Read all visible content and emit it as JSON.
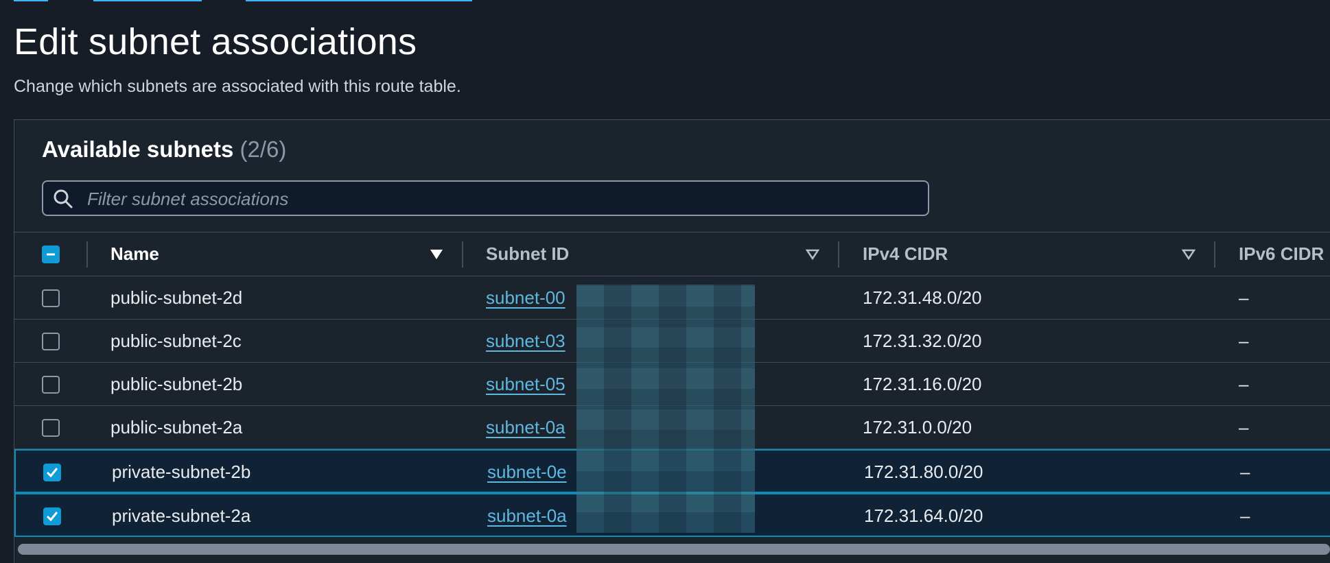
{
  "page": {
    "title": "Edit subnet associations",
    "description": "Change which subnets are associated with this route table."
  },
  "panel": {
    "header": "Available subnets",
    "count": "(2/6)",
    "search_placeholder": "Filter subnet associations"
  },
  "table": {
    "columns": [
      "Name",
      "Subnet ID",
      "IPv4 CIDR",
      "IPv6 CIDR"
    ],
    "rows": [
      {
        "name": "public-subnet-2d",
        "subnet_id": "subnet-00",
        "ipv4": "172.31.48.0/20",
        "ipv6": "–",
        "selected": false
      },
      {
        "name": "public-subnet-2c",
        "subnet_id": "subnet-03",
        "ipv4": "172.31.32.0/20",
        "ipv6": "–",
        "selected": false
      },
      {
        "name": "public-subnet-2b",
        "subnet_id": "subnet-05",
        "ipv4": "172.31.16.0/20",
        "ipv6": "–",
        "selected": false
      },
      {
        "name": "public-subnet-2a",
        "subnet_id": "subnet-0a",
        "ipv4": "172.31.0.0/20",
        "ipv6": "–",
        "selected": false
      },
      {
        "name": "private-subnet-2b",
        "subnet_id": "subnet-0e",
        "ipv4": "172.31.80.0/20",
        "ipv6": "–",
        "selected": true
      },
      {
        "name": "private-subnet-2a",
        "subnet_id": "subnet-0a",
        "ipv4": "172.31.64.0/20",
        "ipv6": "–",
        "selected": true
      }
    ]
  },
  "colors": {
    "background": "#161d26",
    "panel": "#1b232d",
    "accent": "#0f9bd6",
    "link": "#5fb8e0",
    "selected_row": "#0f2236"
  }
}
